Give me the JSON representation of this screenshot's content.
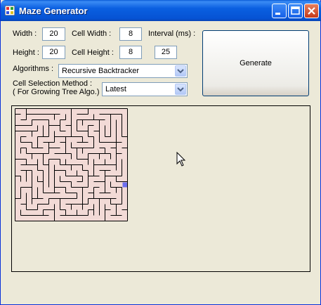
{
  "window": {
    "title": "Maze Generator"
  },
  "form": {
    "width_label": "Width :",
    "width_value": "20",
    "cell_width_label": "Cell Width :",
    "cell_width_value": "8",
    "interval_label": "Interval (ms) :",
    "interval_value": "25",
    "height_label": "Height :",
    "height_value": "20",
    "cell_height_label": "Cell Height :",
    "cell_height_value": "8",
    "algorithms_label": "Algorithms :",
    "algorithm_selected": "Recursive Backtracker",
    "cell_selection_label_line1": "Cell Selection Method :",
    "cell_selection_label_line2": "( For Growing Tree Algo.)",
    "cell_selection_selected": "Latest",
    "generate_label": "Generate"
  },
  "maze": {
    "cols": 20,
    "rows": 20,
    "fill_color": "#f2dad6",
    "wall_color": "#000000",
    "current_cell_color": "#6d6ff0",
    "current_cell": {
      "col": 19,
      "row": 13
    }
  },
  "colors": {
    "window_bg": "#ece9d8",
    "titlebar": "#0a5fe0",
    "border": "#7f9db9"
  }
}
